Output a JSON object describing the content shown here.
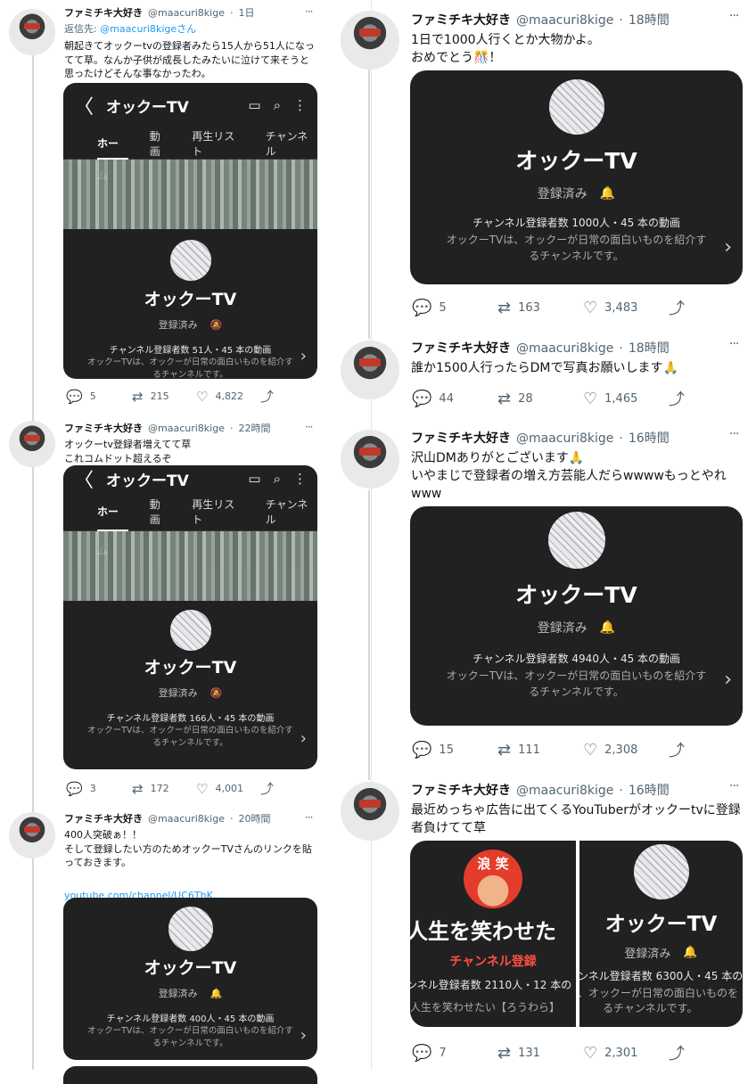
{
  "user": {
    "name": "ファミチキ大好き",
    "handle": "@maacuri8kige"
  },
  "channel": {
    "name": "オックーTV",
    "subscribed": "登録済み",
    "desc_line1": "オックーTVは、オックーが日常の面白いものを紹介す",
    "desc_line2": "るチャンネルです。"
  },
  "yt_header": {
    "back": "〈",
    "title": "オックーTV",
    "tabs": [
      "ホーム",
      "動画",
      "再生リスト",
      "チャンネル"
    ]
  },
  "tweets": [
    {
      "time": "1日",
      "reply_to_label": "返信先: ",
      "reply_to_user": "@maacuri8kige",
      "reply_to_suffix": "さん",
      "text": "朝起きてオックーtvの登録者みたら15人から51人になってて草。なんか子供が成長したみたいに泣けて来そうと思ったけどそんな事なかったわ。",
      "stats": "チャンネル登録者数 51人・45 本の動画",
      "replies": "5",
      "retweets": "215",
      "likes": "4,822"
    },
    {
      "time": "22時間",
      "text": "オックーtv登録者増えてて草\nこれコムドット超えるぞ",
      "stats": "チャンネル登録者数 166人・45 本の動画",
      "replies": "3",
      "retweets": "172",
      "likes": "4,001"
    },
    {
      "time": "20時間",
      "text": "400人突破ぁ！！\nそして登録したい方のためオックーTVさんのリンクを貼っておきます。",
      "link": "youtube.com/channel/UC6ThK...",
      "stats": "チャンネル登録者数 400人・45 本の動画"
    },
    {
      "time": "18時間",
      "text": "1日で1000人行くとか大物かよ。\nおめでとう🎊！",
      "stats": "チャンネル登録者数 1000人・45 本の動画",
      "replies": "5",
      "retweets": "163",
      "likes": "3,483"
    },
    {
      "time": "18時間",
      "text": "誰か1500人行ったらDMで写真お願いします🙏",
      "replies": "44",
      "retweets": "28",
      "likes": "1,465"
    },
    {
      "time": "16時間",
      "text": "沢山DMありがとございます🙏\nいやまじで登録者の増え方芸能人だらwwwwもっとやれwww",
      "stats": "チャンネル登録者数 4940人・45 本の動画",
      "replies": "15",
      "retweets": "111",
      "likes": "2,308"
    },
    {
      "time": "16時間",
      "text": "最近めっちゃ広告に出てくるYouTuberがオックーtvに登録者負けてて草",
      "left_badge": "浪 笑",
      "left_title": "人生を笑わせた",
      "left_sub_button": "チャンネル登録",
      "left_stats": "ンネル登録者数 2110人・12 本の",
      "left_desc": "人生を笑わせたい【ろうわら】",
      "right_stats": "ンネル登録者数 6300人・45 本の",
      "right_desc1": "、オックーが日常の面白いものを",
      "right_desc2": "るチャンネルです。",
      "replies": "7",
      "retweets": "131",
      "likes": "2,301"
    }
  ],
  "icons": {
    "reply": "💬",
    "retweet": "⇄",
    "like": "♡",
    "share": "⤴",
    "cast": "▭",
    "search": "⌕",
    "menu": "⋮",
    "bell": "🔔",
    "bell_off": "🔕",
    "chevron": "›",
    "more": "···"
  },
  "colors": {
    "link": "#1d9bf0",
    "card": "#212121",
    "muted": "#536471",
    "subscribe_red": "#ff4e45"
  }
}
